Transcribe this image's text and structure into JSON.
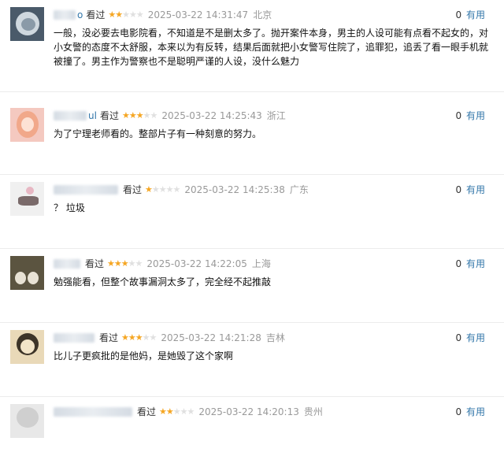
{
  "colors": {
    "star_on": "#f5a623",
    "star_off": "#e0e0e0",
    "link": "#3377aa",
    "meta": "#999999"
  },
  "icons": {
    "star": "star-icon"
  },
  "reviews": [
    {
      "username_fragment": "o",
      "status": "看过",
      "rating": 2,
      "time": "2025-03-22 14:31:47",
      "location": "北京",
      "votes": "0",
      "useful_label": "有用",
      "content": "一般，没必要去电影院看，不知道是不是删太多了。抛开案件本身，男主的人设可能有点看不起女的，对小女警的态度不太舒服，本来以为有反转，结果后面就把小女警写住院了，追罪犯，追丢了看一眼手机就被撞了。男主作为警察也不是聪明严谨的人设，没什么魅力"
    },
    {
      "username_fragment": "ul",
      "status": "看过",
      "rating": 3,
      "time": "2025-03-22 14:25:43",
      "location": "浙江",
      "votes": "0",
      "useful_label": "有用",
      "content": "为了宁理老师看的。整部片子有一种刻意的努力。"
    },
    {
      "username_fragment": "",
      "status": "看过",
      "rating": 1,
      "time": "2025-03-22 14:25:38",
      "location": "广东",
      "votes": "0",
      "useful_label": "有用",
      "content": "？ 垃圾"
    },
    {
      "username_fragment": "",
      "status": "看过",
      "rating": 3,
      "time": "2025-03-22 14:22:05",
      "location": "上海",
      "votes": "0",
      "useful_label": "有用",
      "content": "勉强能看，但整个故事漏洞太多了，完全经不起推敲"
    },
    {
      "username_fragment": "",
      "status": "看过",
      "rating": 3,
      "time": "2025-03-22 14:21:28",
      "location": "吉林",
      "votes": "0",
      "useful_label": "有用",
      "content": "比儿子更疯批的是他妈，是她毁了这个家啊"
    },
    {
      "username_fragment": "",
      "status": "看过",
      "rating": 2,
      "time": "2025-03-22 14:20:13",
      "location": "贵州",
      "votes": "0",
      "useful_label": "有用",
      "content": ""
    }
  ]
}
